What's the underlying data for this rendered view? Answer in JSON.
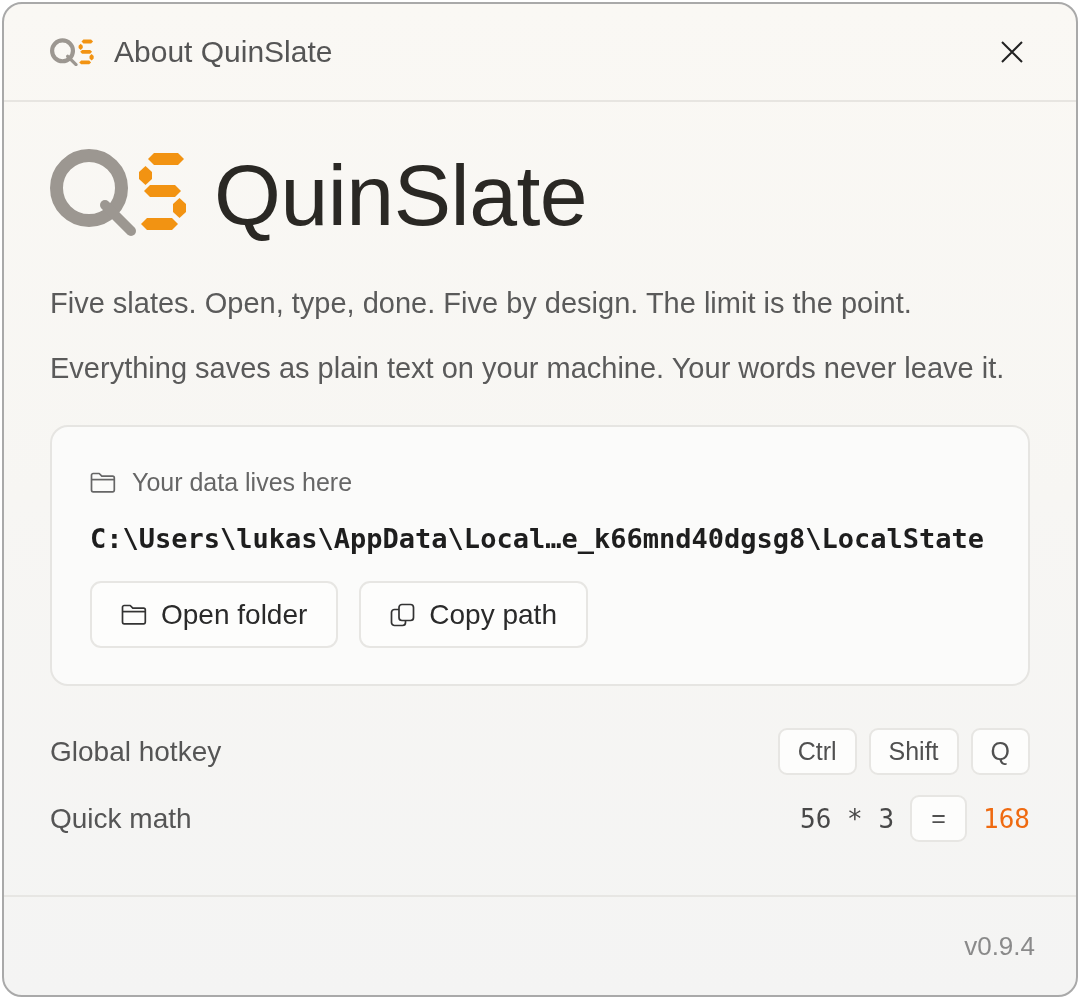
{
  "window": {
    "title": "About QuinSlate"
  },
  "brand": {
    "name": "QuinSlate"
  },
  "taglines": [
    "Five slates. Open, type, done. Five by design. The limit is the point.",
    "Everything saves as plain text on your machine. Your words never leave it."
  ],
  "data_location": {
    "label": "Your data lives here",
    "path": "C:\\Users\\lukas\\AppData\\Local…e_k66mnd40dgsg8\\LocalState",
    "buttons": [
      {
        "kind": "folder",
        "label": "Open folder"
      },
      {
        "kind": "copy",
        "label": "Copy path"
      }
    ]
  },
  "settings": [
    {
      "kind": "hotkey",
      "label": "Global hotkey",
      "keys": [
        "Ctrl",
        "Shift",
        "Q"
      ]
    },
    {
      "kind": "math",
      "label": "Quick math",
      "expression": "56 * 3",
      "equals_key": "=",
      "result": "168"
    }
  ],
  "footer": {
    "version": "v0.9.4"
  }
}
